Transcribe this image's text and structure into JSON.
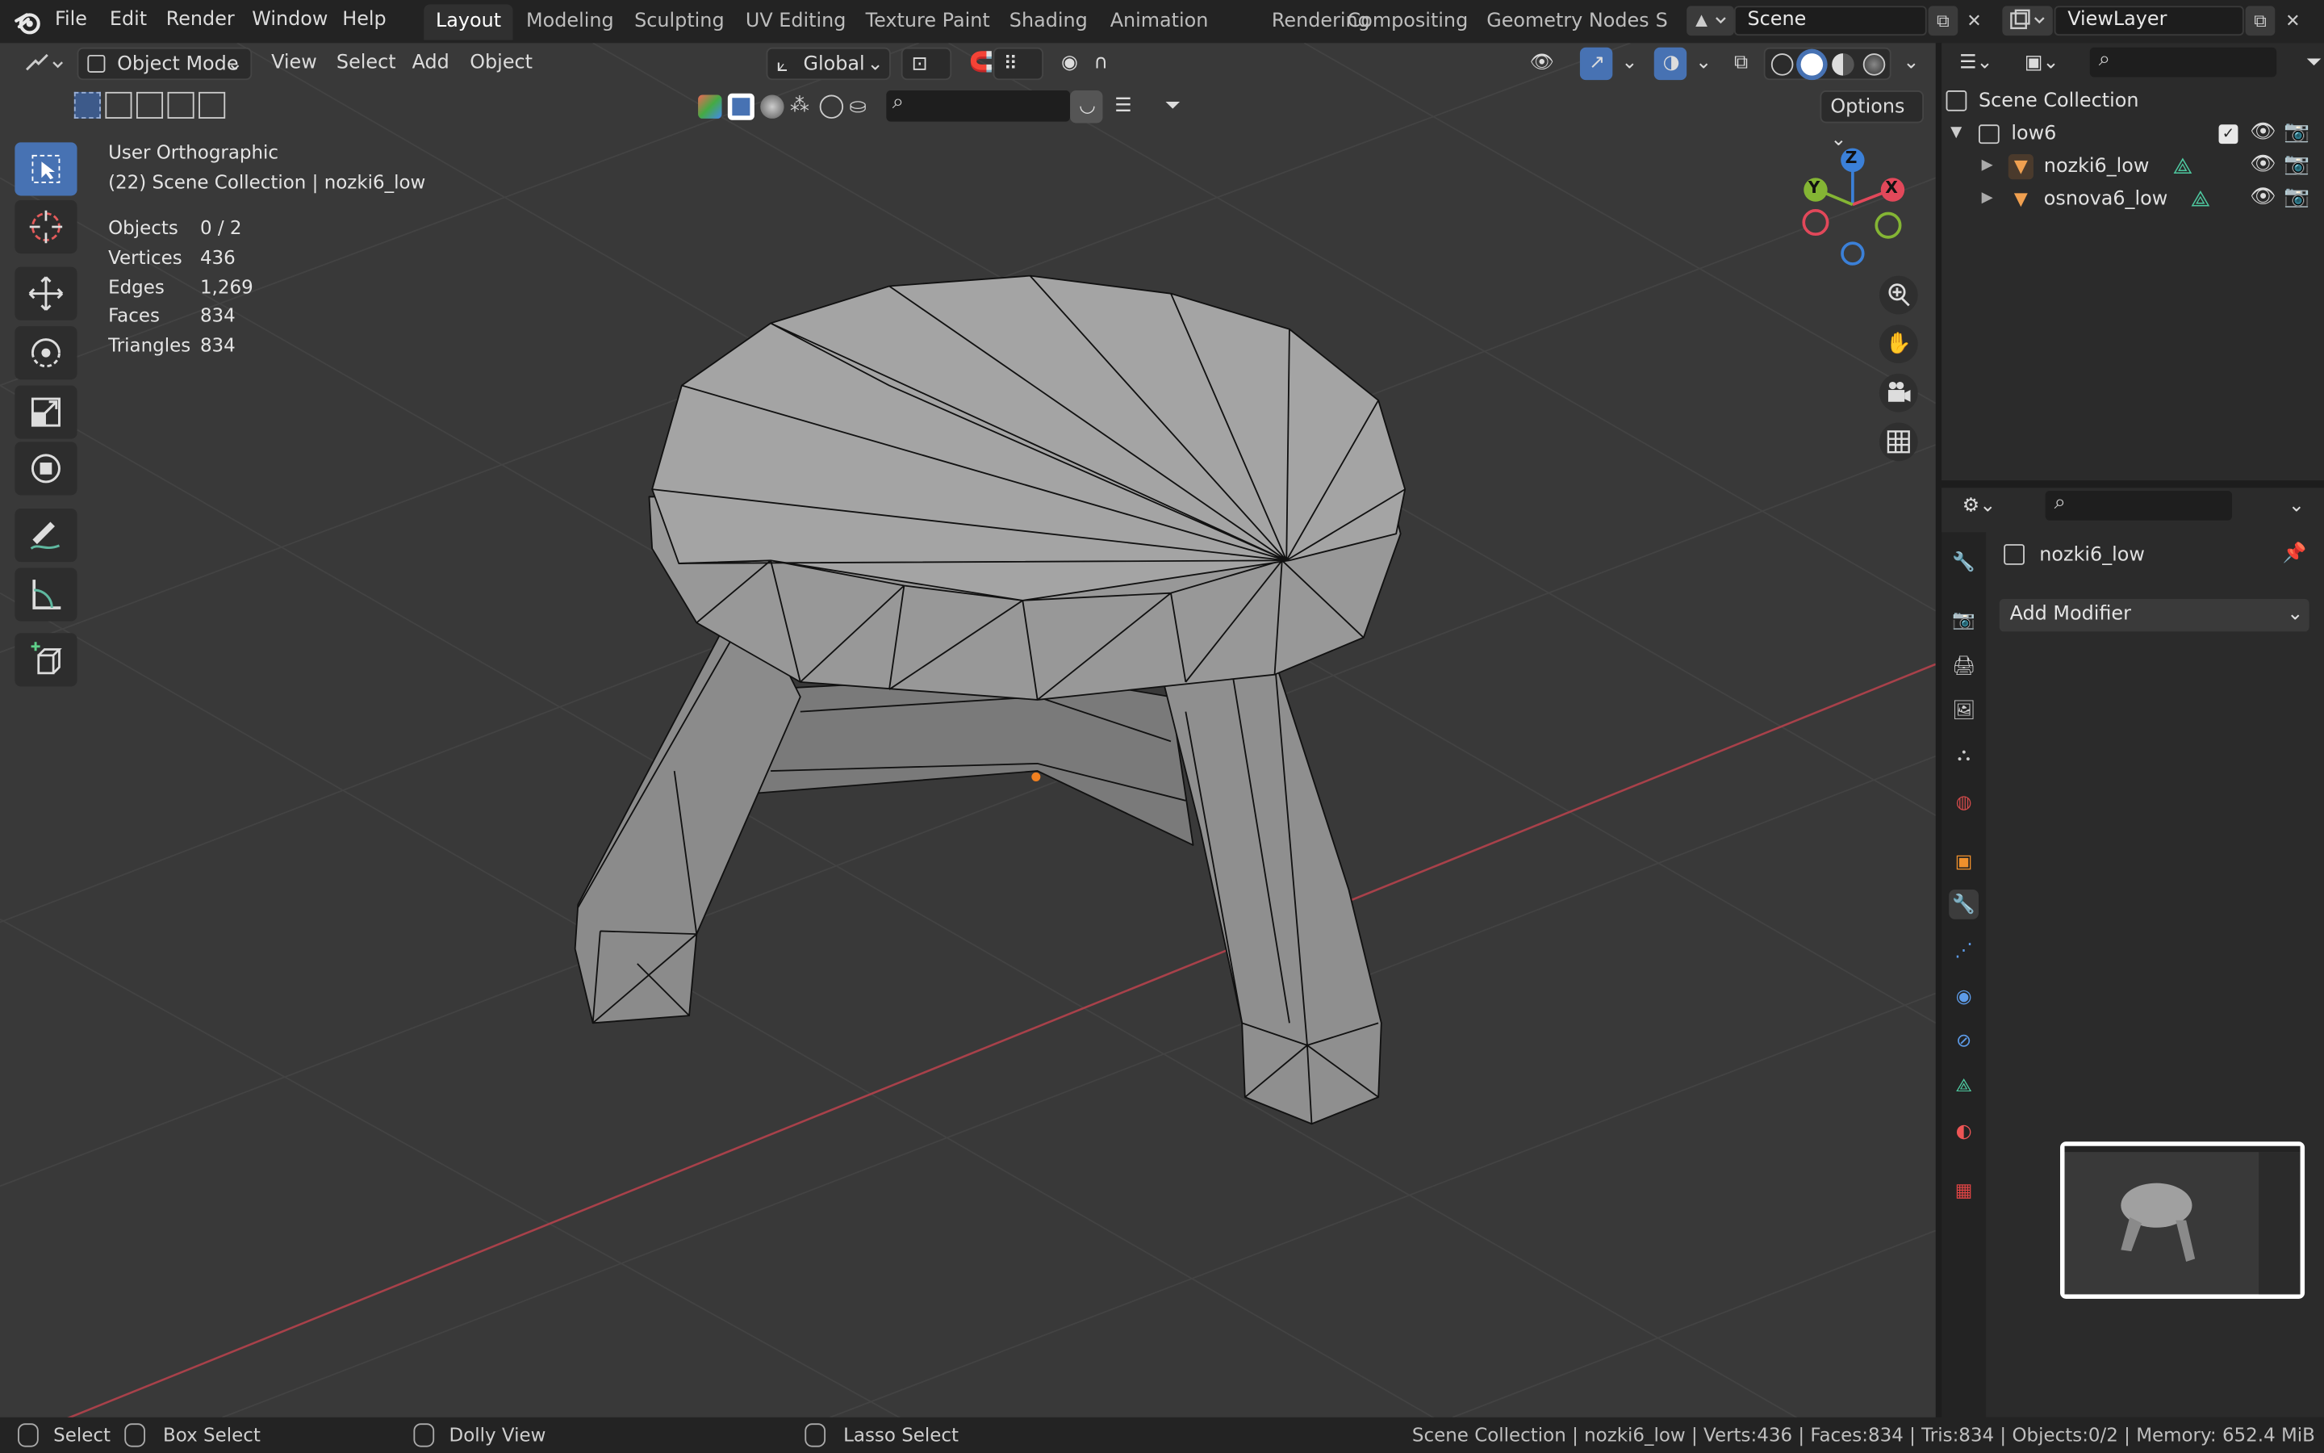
{
  "app": {
    "logo_icon": "blender-logo-icon",
    "menus": [
      "File",
      "Edit",
      "Render",
      "Window",
      "Help"
    ],
    "workspaces": [
      "Layout",
      "Modeling",
      "Sculpting",
      "UV Editing",
      "Texture Paint",
      "Shading",
      "Animation",
      "Rendering",
      "Compositing",
      "Geometry Nodes",
      "S"
    ],
    "active_workspace": "Layout",
    "scene_name": "Scene",
    "view_layer": "ViewLayer"
  },
  "viewport_header": {
    "mode": "Object Mode",
    "menus": [
      "View",
      "Select",
      "Add",
      "Object"
    ],
    "orientation": "Global",
    "options_label": "Options"
  },
  "overlay_text": {
    "view_name": "User Orthographic",
    "collection_line": "(22) Scene Collection | nozki6_low",
    "stats": [
      {
        "label": "Objects",
        "value": "0 / 2"
      },
      {
        "label": "Vertices",
        "value": "436"
      },
      {
        "label": "Edges",
        "value": "1,269"
      },
      {
        "label": "Faces",
        "value": "834"
      },
      {
        "label": "Triangles",
        "value": "834"
      }
    ]
  },
  "gizmo": {
    "z": "Z",
    "y": "Y",
    "x": "X",
    "x_color": "#e2485a",
    "y_color": "#84b534",
    "z_color": "#3b80d8"
  },
  "outliner": {
    "root": "Scene Collection",
    "collection": "low6",
    "objects": [
      "nozki6_low",
      "osnova6_low"
    ]
  },
  "properties": {
    "object_name": "nozki6_low",
    "add_modifier": "Add Modifier"
  },
  "statusbar": {
    "select": "Select",
    "box_select": "Box Select",
    "dolly_view": "Dolly View",
    "lasso_select": "Lasso Select",
    "info": "Scene Collection | nozki6_low | Verts:436 | Faces:834 | Tris:834 | Objects:0/2 | Memory: 652.4 MiB"
  },
  "colors": {
    "accent": "#4772b3",
    "x_axis": "#c8404e",
    "mesh": "#8c8c8c",
    "origin": "#f08020"
  }
}
